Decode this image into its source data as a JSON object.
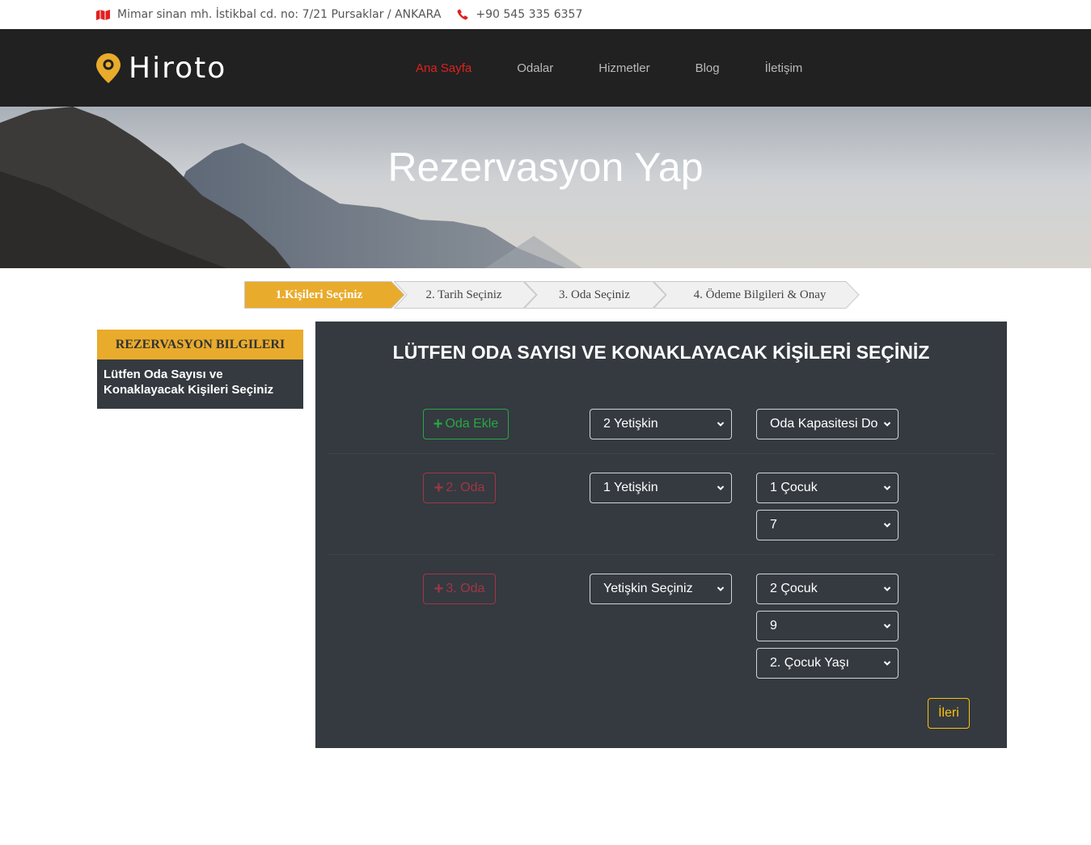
{
  "topbar": {
    "address": "Mimar sinan mh. İstikbal cd. no: 7/21 Pursaklar / ANKARA",
    "phone": "+90 545 335 6357"
  },
  "brand": {
    "name": "Hiroto"
  },
  "nav": [
    "Ana Sayfa",
    "Odalar",
    "Hizmetler",
    "Blog",
    "İletişim"
  ],
  "hero": {
    "title": "Rezervasyon Yap"
  },
  "steps": [
    "1.Kişileri Seçiniz",
    "2. Tarih Seçiniz",
    "3. Oda Seçiniz",
    "4. Ödeme Bilgileri & Onay"
  ],
  "sidebar": {
    "heading": "REZERVASYON BILGILERI",
    "body": "Lütfen Oda Sayısı ve Konaklayacak Kişileri Seçiniz"
  },
  "panel": {
    "title": "LÜTFEN ODA SAYISI VE KONAKLAYACAK KİŞİLERİ SEÇİNİZ",
    "rows": [
      {
        "button": "Oda Ekle",
        "adults": "2 Yetişkin",
        "children": [
          "Oda Kapasitesi Do"
        ]
      },
      {
        "button": "2. Oda",
        "adults": "1 Yetişkin",
        "children": [
          "1 Çocuk",
          "7"
        ]
      },
      {
        "button": "3. Oda",
        "adults": "Yetişkin Seçiniz",
        "children": [
          "2 Çocuk",
          "9",
          "2. Çocuk Yaşı"
        ]
      }
    ],
    "next": "İleri"
  },
  "colors": {
    "accent": "#e9ab2c",
    "nav_active": "#e0201f",
    "panel_bg": "#343a40",
    "success": "#28a745",
    "danger": "#dc3545",
    "warning": "#ffc107"
  }
}
